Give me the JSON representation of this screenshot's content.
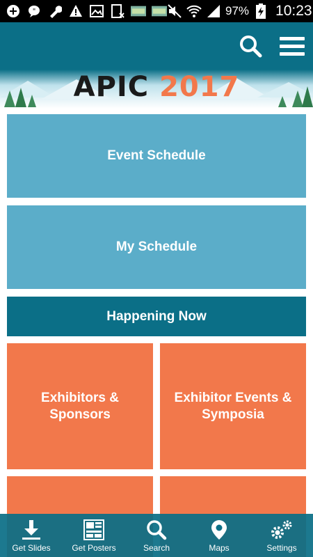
{
  "status_bar": {
    "battery_percent": "97%",
    "time": "10:23",
    "icons": [
      "add-icon",
      "chat-icon",
      "wrench-icon",
      "warning-icon",
      "image-icon",
      "sheet-icon",
      "ticket-icon",
      "ticket-icon",
      "mute-icon",
      "wifi-icon",
      "signal-icon",
      "battery-charging-icon"
    ]
  },
  "app_bar": {
    "icons": [
      "search-icon",
      "menu-icon"
    ]
  },
  "banner": {
    "brand": "APIC",
    "year": "2017"
  },
  "tiles": {
    "event_schedule": "Event Schedule",
    "my_schedule": "My Schedule",
    "happening_now": "Happening Now",
    "exhibitors_sponsors": "Exhibitors & Sponsors",
    "exhibitor_events": "Exhibitor Events & Symposia"
  },
  "tab_bar": {
    "items": [
      {
        "label": "Get Slides",
        "icon": "download-icon"
      },
      {
        "label": "Get Posters",
        "icon": "poster-icon"
      },
      {
        "label": "Search",
        "icon": "search-icon"
      },
      {
        "label": "Maps",
        "icon": "map-pin-icon"
      },
      {
        "label": "Settings",
        "icon": "gears-icon"
      }
    ]
  },
  "colors": {
    "primary": "#0b6f87",
    "light_blue": "#5badc9",
    "orange": "#f2784b"
  }
}
